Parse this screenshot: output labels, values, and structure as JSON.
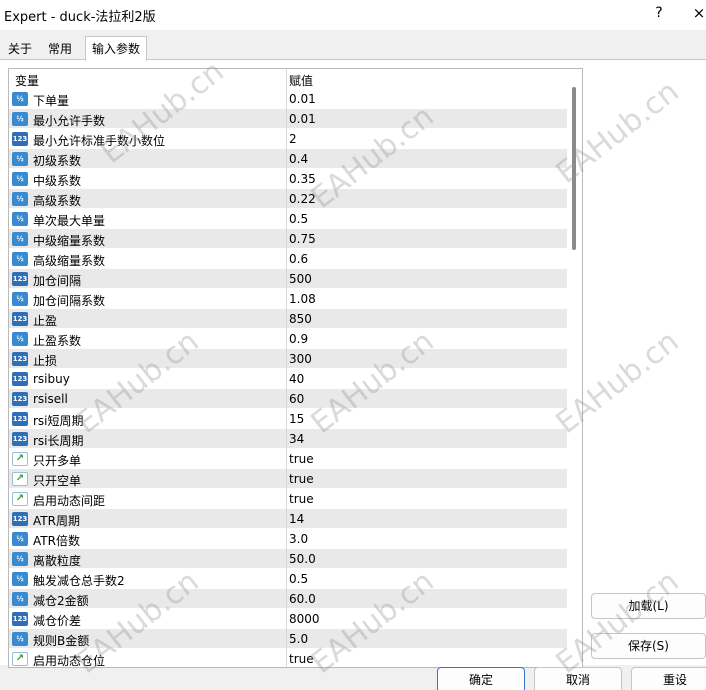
{
  "window": {
    "title": "Expert - duck-法拉利2版",
    "help": "?",
    "close": "×"
  },
  "tabs": [
    {
      "label": "关于"
    },
    {
      "label": "常用"
    },
    {
      "label": "输入参数"
    }
  ],
  "grid": {
    "col_variable": "变量",
    "col_value": "赋值",
    "rows": [
      {
        "type": "v12",
        "icon": "½",
        "name": "下单量",
        "value": "0.01"
      },
      {
        "type": "v12",
        "icon": "½",
        "name": "最小允许手数",
        "value": "0.01"
      },
      {
        "type": "v123",
        "icon": "123",
        "name": "最小允许标准手数小数位",
        "value": "2"
      },
      {
        "type": "v12",
        "icon": "½",
        "name": "初级系数",
        "value": "0.4"
      },
      {
        "type": "v12",
        "icon": "½",
        "name": "中级系数",
        "value": "0.35"
      },
      {
        "type": "v12",
        "icon": "½",
        "name": "高级系数",
        "value": "0.22"
      },
      {
        "type": "v12",
        "icon": "½",
        "name": "单次最大单量",
        "value": "0.5"
      },
      {
        "type": "v12",
        "icon": "½",
        "name": "中级缩量系数",
        "value": "0.75"
      },
      {
        "type": "v12",
        "icon": "½",
        "name": "高级缩量系数",
        "value": "0.6"
      },
      {
        "type": "v123",
        "icon": "123",
        "name": "加仓间隔",
        "value": "500"
      },
      {
        "type": "v12",
        "icon": "½",
        "name": "加仓间隔系数",
        "value": "1.08"
      },
      {
        "type": "v123",
        "icon": "123",
        "name": "止盈",
        "value": "850"
      },
      {
        "type": "v12",
        "icon": "½",
        "name": "止盈系数",
        "value": "0.9"
      },
      {
        "type": "v123",
        "icon": "123",
        "name": "止损",
        "value": "300"
      },
      {
        "type": "v123",
        "icon": "123",
        "name": "rsibuy",
        "value": "40"
      },
      {
        "type": "v123",
        "icon": "123",
        "name": "rsisell",
        "value": "60"
      },
      {
        "type": "v123",
        "icon": "123",
        "name": "rsi短周期",
        "value": "15"
      },
      {
        "type": "v123",
        "icon": "123",
        "name": "rsi长周期",
        "value": "34"
      },
      {
        "type": "bool",
        "icon": "↗",
        "name": "只开多单",
        "value": "true"
      },
      {
        "type": "bool",
        "icon": "↗",
        "name": "只开空单",
        "value": "true"
      },
      {
        "type": "bool",
        "icon": "↗",
        "name": "启用动态间距",
        "value": "true"
      },
      {
        "type": "v123",
        "icon": "123",
        "name": "ATR周期",
        "value": "14"
      },
      {
        "type": "v12",
        "icon": "½",
        "name": "ATR倍数",
        "value": "3.0"
      },
      {
        "type": "v12",
        "icon": "½",
        "name": "离散粒度",
        "value": "50.0"
      },
      {
        "type": "v12",
        "icon": "½",
        "name": "触发减仓总手数2",
        "value": "0.5"
      },
      {
        "type": "v12",
        "icon": "½",
        "name": "减仓2金额",
        "value": "60.0"
      },
      {
        "type": "v123",
        "icon": "123",
        "name": "减仓价差",
        "value": "8000"
      },
      {
        "type": "v12",
        "icon": "½",
        "name": "规则B金额",
        "value": "5.0"
      },
      {
        "type": "bool",
        "icon": "↗",
        "name": "启用动态仓位",
        "value": "true"
      }
    ]
  },
  "side_buttons": {
    "load": "加载(L)",
    "save": "保存(S)"
  },
  "footer_buttons": {
    "ok": "确定",
    "cancel": "取消",
    "reset": "重设"
  },
  "watermark": "EAHub.cn"
}
